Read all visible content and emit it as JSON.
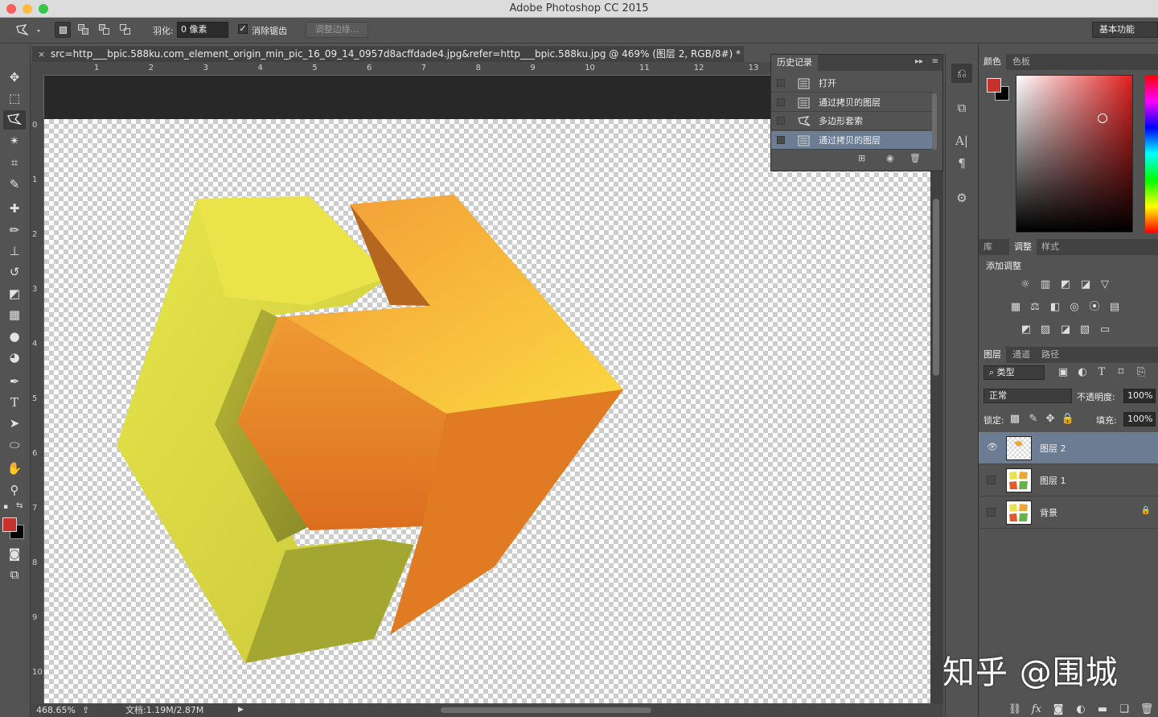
{
  "window": {
    "title": "Adobe Photoshop CC 2015"
  },
  "options_bar": {
    "feather_label": "羽化:",
    "feather_value": "0 像素",
    "antialias_label": "消除锯齿",
    "antialias_checked": "✓",
    "refine_edge_label": "调整边缘...",
    "workspace": "基本功能"
  },
  "document": {
    "tab_title": "src=http___bpic.588ku.com_element_origin_min_pic_16_09_14_0957d8acffdade4.jpg&refer=http___bpic.588ku.jpg @ 469% (图层 2, RGB/8#) *",
    "close": "×",
    "h_ruler_ticks": [
      "1",
      "2",
      "3",
      "4",
      "5",
      "6",
      "7",
      "8",
      "9",
      "10",
      "11",
      "12",
      "13"
    ],
    "v_ruler_ticks": [
      "0",
      "1",
      "2",
      "3",
      "4",
      "5",
      "6",
      "7",
      "8",
      "9",
      "10"
    ]
  },
  "status_bar": {
    "zoom": "468.65%",
    "doc_size": "文档:1.19M/2.87M",
    "arrow": "▶"
  },
  "history_panel": {
    "tab_label": "历史记录",
    "items": [
      {
        "label": "打开"
      },
      {
        "label": "通过拷贝的图层"
      },
      {
        "label": "多边形套索"
      },
      {
        "label": "通过拷贝的图层"
      }
    ]
  },
  "color_panel": {
    "tabs": [
      "颜色",
      "色板"
    ],
    "foreground": "#c6322c",
    "background": "#000000"
  },
  "adjustments_panel": {
    "tabs": [
      "库",
      "调整",
      "样式"
    ],
    "heading": "添加调整"
  },
  "layers_panel": {
    "tabs": [
      "图层",
      "通道",
      "路径"
    ],
    "filter_kind": "⌕ 类型",
    "blend_mode": "正常",
    "opacity_label": "不透明度:",
    "opacity_value": "100%",
    "lock_label": "锁定:",
    "fill_label": "填充:",
    "fill_value": "100%",
    "layers": [
      {
        "name": "图层 2",
        "visible": "👁"
      },
      {
        "name": "图层 1"
      },
      {
        "name": "背景",
        "lock": "🔒"
      }
    ],
    "footer_icons": [
      "link-icon",
      "fx-icon",
      "mask-icon",
      "adjustment-icon",
      "folder-icon",
      "new-layer-icon",
      "trash-icon"
    ],
    "footer_fx": "fx"
  },
  "watermark": {
    "text": "知乎 @围城"
  },
  "colors": {
    "accent_selection": "#6b7c93",
    "cube_yellow": "#e9e24a",
    "cube_orange": "#f0a53a"
  }
}
